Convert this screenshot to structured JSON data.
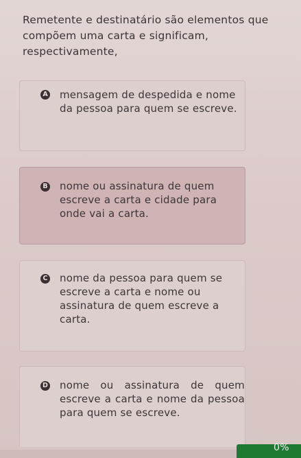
{
  "question": {
    "text": "Remetente e destinatário são elementos que compõem uma carta e significam, respectivamente,"
  },
  "options": [
    {
      "letter": "A",
      "text": "mensagem de despedida e nome da pessoa para quem se escreve."
    },
    {
      "letter": "B",
      "text": "nome ou assinatura de quem escreve a carta e cidade para onde vai a carta."
    },
    {
      "letter": "C",
      "text": "nome da pessoa para quem se escreve a carta e nome ou assinatura de quem escreve a carta."
    },
    {
      "letter": "D",
      "text": "nome ou assinatura de quem escreve a carta e nome da pessoa para quem se escreve."
    }
  ],
  "selected_option": "B",
  "progress": {
    "label": "0%",
    "value": 0,
    "color": "#1e7a33"
  }
}
